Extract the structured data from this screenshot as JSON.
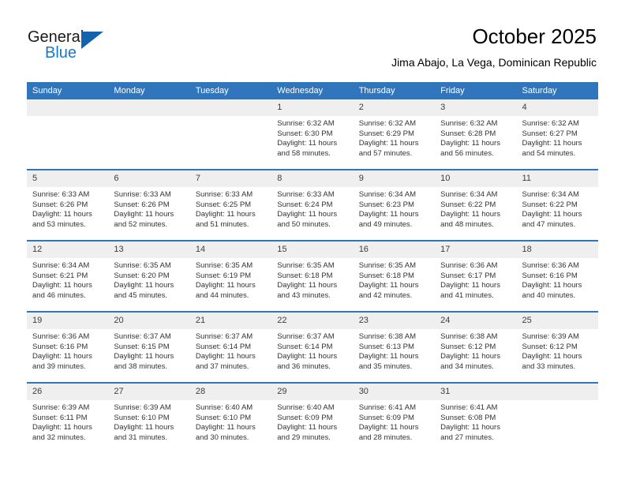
{
  "brand": {
    "name_part1": "General",
    "name_part2": "Blue",
    "triangle_icon": "triangle-icon",
    "accent_color": "#1262ae"
  },
  "header": {
    "title": "October 2025",
    "subtitle": "Jima Abajo, La Vega, Dominican Republic"
  },
  "calendar": {
    "header_bg_color": "#3176bc",
    "daynum_bg_color": "#efefef",
    "weekday_names": [
      "Sunday",
      "Monday",
      "Tuesday",
      "Wednesday",
      "Thursday",
      "Friday",
      "Saturday"
    ],
    "weeks": [
      [
        {
          "day": "",
          "sunrise": "",
          "sunset": "",
          "daylight_line1": "",
          "daylight_line2": ""
        },
        {
          "day": "",
          "sunrise": "",
          "sunset": "",
          "daylight_line1": "",
          "daylight_line2": ""
        },
        {
          "day": "",
          "sunrise": "",
          "sunset": "",
          "daylight_line1": "",
          "daylight_line2": ""
        },
        {
          "day": "1",
          "sunrise": "Sunrise: 6:32 AM",
          "sunset": "Sunset: 6:30 PM",
          "daylight_line1": "Daylight: 11 hours",
          "daylight_line2": "and 58 minutes."
        },
        {
          "day": "2",
          "sunrise": "Sunrise: 6:32 AM",
          "sunset": "Sunset: 6:29 PM",
          "daylight_line1": "Daylight: 11 hours",
          "daylight_line2": "and 57 minutes."
        },
        {
          "day": "3",
          "sunrise": "Sunrise: 6:32 AM",
          "sunset": "Sunset: 6:28 PM",
          "daylight_line1": "Daylight: 11 hours",
          "daylight_line2": "and 56 minutes."
        },
        {
          "day": "4",
          "sunrise": "Sunrise: 6:32 AM",
          "sunset": "Sunset: 6:27 PM",
          "daylight_line1": "Daylight: 11 hours",
          "daylight_line2": "and 54 minutes."
        }
      ],
      [
        {
          "day": "5",
          "sunrise": "Sunrise: 6:33 AM",
          "sunset": "Sunset: 6:26 PM",
          "daylight_line1": "Daylight: 11 hours",
          "daylight_line2": "and 53 minutes."
        },
        {
          "day": "6",
          "sunrise": "Sunrise: 6:33 AM",
          "sunset": "Sunset: 6:26 PM",
          "daylight_line1": "Daylight: 11 hours",
          "daylight_line2": "and 52 minutes."
        },
        {
          "day": "7",
          "sunrise": "Sunrise: 6:33 AM",
          "sunset": "Sunset: 6:25 PM",
          "daylight_line1": "Daylight: 11 hours",
          "daylight_line2": "and 51 minutes."
        },
        {
          "day": "8",
          "sunrise": "Sunrise: 6:33 AM",
          "sunset": "Sunset: 6:24 PM",
          "daylight_line1": "Daylight: 11 hours",
          "daylight_line2": "and 50 minutes."
        },
        {
          "day": "9",
          "sunrise": "Sunrise: 6:34 AM",
          "sunset": "Sunset: 6:23 PM",
          "daylight_line1": "Daylight: 11 hours",
          "daylight_line2": "and 49 minutes."
        },
        {
          "day": "10",
          "sunrise": "Sunrise: 6:34 AM",
          "sunset": "Sunset: 6:22 PM",
          "daylight_line1": "Daylight: 11 hours",
          "daylight_line2": "and 48 minutes."
        },
        {
          "day": "11",
          "sunrise": "Sunrise: 6:34 AM",
          "sunset": "Sunset: 6:22 PM",
          "daylight_line1": "Daylight: 11 hours",
          "daylight_line2": "and 47 minutes."
        }
      ],
      [
        {
          "day": "12",
          "sunrise": "Sunrise: 6:34 AM",
          "sunset": "Sunset: 6:21 PM",
          "daylight_line1": "Daylight: 11 hours",
          "daylight_line2": "and 46 minutes."
        },
        {
          "day": "13",
          "sunrise": "Sunrise: 6:35 AM",
          "sunset": "Sunset: 6:20 PM",
          "daylight_line1": "Daylight: 11 hours",
          "daylight_line2": "and 45 minutes."
        },
        {
          "day": "14",
          "sunrise": "Sunrise: 6:35 AM",
          "sunset": "Sunset: 6:19 PM",
          "daylight_line1": "Daylight: 11 hours",
          "daylight_line2": "and 44 minutes."
        },
        {
          "day": "15",
          "sunrise": "Sunrise: 6:35 AM",
          "sunset": "Sunset: 6:18 PM",
          "daylight_line1": "Daylight: 11 hours",
          "daylight_line2": "and 43 minutes."
        },
        {
          "day": "16",
          "sunrise": "Sunrise: 6:35 AM",
          "sunset": "Sunset: 6:18 PM",
          "daylight_line1": "Daylight: 11 hours",
          "daylight_line2": "and 42 minutes."
        },
        {
          "day": "17",
          "sunrise": "Sunrise: 6:36 AM",
          "sunset": "Sunset: 6:17 PM",
          "daylight_line1": "Daylight: 11 hours",
          "daylight_line2": "and 41 minutes."
        },
        {
          "day": "18",
          "sunrise": "Sunrise: 6:36 AM",
          "sunset": "Sunset: 6:16 PM",
          "daylight_line1": "Daylight: 11 hours",
          "daylight_line2": "and 40 minutes."
        }
      ],
      [
        {
          "day": "19",
          "sunrise": "Sunrise: 6:36 AM",
          "sunset": "Sunset: 6:16 PM",
          "daylight_line1": "Daylight: 11 hours",
          "daylight_line2": "and 39 minutes."
        },
        {
          "day": "20",
          "sunrise": "Sunrise: 6:37 AM",
          "sunset": "Sunset: 6:15 PM",
          "daylight_line1": "Daylight: 11 hours",
          "daylight_line2": "and 38 minutes."
        },
        {
          "day": "21",
          "sunrise": "Sunrise: 6:37 AM",
          "sunset": "Sunset: 6:14 PM",
          "daylight_line1": "Daylight: 11 hours",
          "daylight_line2": "and 37 minutes."
        },
        {
          "day": "22",
          "sunrise": "Sunrise: 6:37 AM",
          "sunset": "Sunset: 6:14 PM",
          "daylight_line1": "Daylight: 11 hours",
          "daylight_line2": "and 36 minutes."
        },
        {
          "day": "23",
          "sunrise": "Sunrise: 6:38 AM",
          "sunset": "Sunset: 6:13 PM",
          "daylight_line1": "Daylight: 11 hours",
          "daylight_line2": "and 35 minutes."
        },
        {
          "day": "24",
          "sunrise": "Sunrise: 6:38 AM",
          "sunset": "Sunset: 6:12 PM",
          "daylight_line1": "Daylight: 11 hours",
          "daylight_line2": "and 34 minutes."
        },
        {
          "day": "25",
          "sunrise": "Sunrise: 6:39 AM",
          "sunset": "Sunset: 6:12 PM",
          "daylight_line1": "Daylight: 11 hours",
          "daylight_line2": "and 33 minutes."
        }
      ],
      [
        {
          "day": "26",
          "sunrise": "Sunrise: 6:39 AM",
          "sunset": "Sunset: 6:11 PM",
          "daylight_line1": "Daylight: 11 hours",
          "daylight_line2": "and 32 minutes."
        },
        {
          "day": "27",
          "sunrise": "Sunrise: 6:39 AM",
          "sunset": "Sunset: 6:10 PM",
          "daylight_line1": "Daylight: 11 hours",
          "daylight_line2": "and 31 minutes."
        },
        {
          "day": "28",
          "sunrise": "Sunrise: 6:40 AM",
          "sunset": "Sunset: 6:10 PM",
          "daylight_line1": "Daylight: 11 hours",
          "daylight_line2": "and 30 minutes."
        },
        {
          "day": "29",
          "sunrise": "Sunrise: 6:40 AM",
          "sunset": "Sunset: 6:09 PM",
          "daylight_line1": "Daylight: 11 hours",
          "daylight_line2": "and 29 minutes."
        },
        {
          "day": "30",
          "sunrise": "Sunrise: 6:41 AM",
          "sunset": "Sunset: 6:09 PM",
          "daylight_line1": "Daylight: 11 hours",
          "daylight_line2": "and 28 minutes."
        },
        {
          "day": "31",
          "sunrise": "Sunrise: 6:41 AM",
          "sunset": "Sunset: 6:08 PM",
          "daylight_line1": "Daylight: 11 hours",
          "daylight_line2": "and 27 minutes."
        },
        {
          "day": "",
          "sunrise": "",
          "sunset": "",
          "daylight_line1": "",
          "daylight_line2": ""
        }
      ]
    ]
  }
}
